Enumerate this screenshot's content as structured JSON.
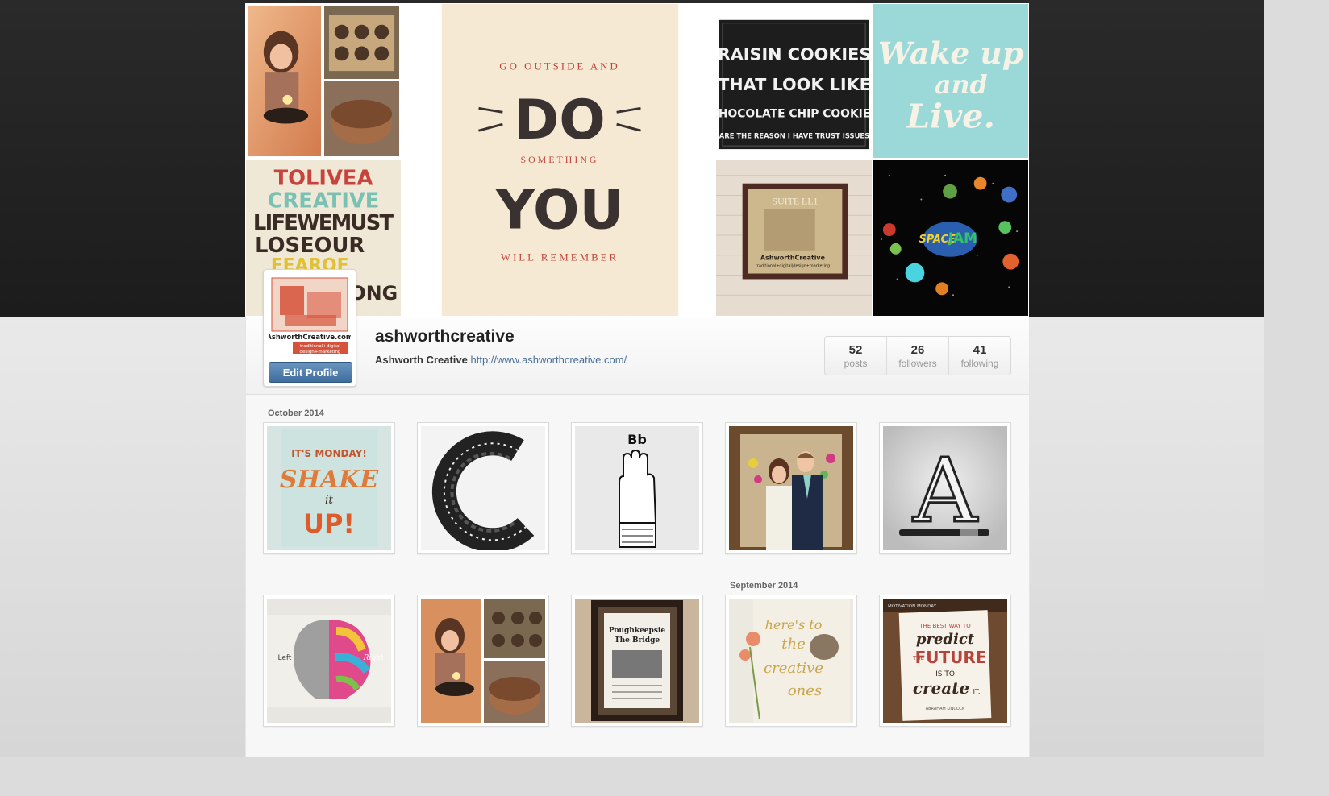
{
  "cover": {
    "tiles": [
      {
        "name": "cover-tile-birthday-collage",
        "caption": ""
      },
      {
        "name": "cover-tile-do-something",
        "text": [
          "GO OUTSIDE AND",
          "DO",
          "SOMETHING",
          "YOU",
          "WILL REMEMBER"
        ]
      },
      {
        "name": "cover-tile-raisin-cookies",
        "text": [
          "RAISIN COOKIES",
          "THAT LOOK LIKE",
          "CHOCOLATE CHIP COOKIES",
          "ARE THE REASON I HAVE TRUST ISSUES"
        ]
      },
      {
        "name": "cover-tile-wake-up",
        "text": [
          "Wake up",
          "and",
          "Live."
        ]
      },
      {
        "name": "cover-tile-to-live-creative",
        "text": [
          "TOLIVEA",
          "CREATIVE",
          "LIFEWEMUST",
          "LOSEOUR",
          "FEAROF",
          "ONG"
        ]
      },
      {
        "name": "cover-tile-suite-sign",
        "text": [
          "SUITE LL1",
          "AshworthCreative",
          "traditional+digital|design+marketing"
        ]
      },
      {
        "name": "cover-tile-space-jam",
        "text": [
          "SPACE",
          "JAM"
        ]
      }
    ]
  },
  "profile": {
    "username": "ashworthcreative",
    "full_name": "Ashworth Creative",
    "website": "http://www.ashworthcreative.com/",
    "edit_button": "Edit Profile",
    "avatar_text": [
      "AshworthCreative.com",
      "traditional+digital",
      "design+marketing"
    ],
    "stats": [
      {
        "value": "52",
        "label": "posts"
      },
      {
        "value": "26",
        "label": "followers"
      },
      {
        "value": "41",
        "label": "following"
      }
    ]
  },
  "feed": {
    "month_1": "October 2014",
    "month_2": "September 2014",
    "row1": [
      {
        "name": "photo-shake-it-up",
        "text": [
          "IT'S MONDAY!",
          "SHAKE",
          "it",
          "UP!"
        ]
      },
      {
        "name": "photo-letter-c",
        "text": []
      },
      {
        "name": "photo-bb-hand",
        "text": [
          "Bb"
        ]
      },
      {
        "name": "photo-couple",
        "text": []
      },
      {
        "name": "photo-letter-a",
        "text": [
          "A"
        ]
      }
    ],
    "row2": [
      {
        "name": "photo-left-right-brain",
        "text": [
          "Left",
          "Right"
        ]
      },
      {
        "name": "photo-birthday-collage",
        "text": []
      },
      {
        "name": "photo-framed-print",
        "text": [
          "Poughkeepsie",
          "The Bridge"
        ]
      },
      {
        "name": "photo-creative-ones",
        "text": [
          "here's to",
          "the",
          "creative",
          "ones"
        ]
      },
      {
        "name": "photo-predict-future",
        "text": [
          "MOTIVATION MONDAY",
          "THE BEST WAY TO",
          "predict",
          "THE",
          "FUTURE",
          "IS TO",
          "create",
          "IT.",
          "ABRAHAM LINCOLN"
        ]
      }
    ]
  },
  "colors": {
    "link": "#4a6f97",
    "button": "#4f7eae",
    "background_dark": "#222222",
    "panel": "#f7f7f7"
  }
}
